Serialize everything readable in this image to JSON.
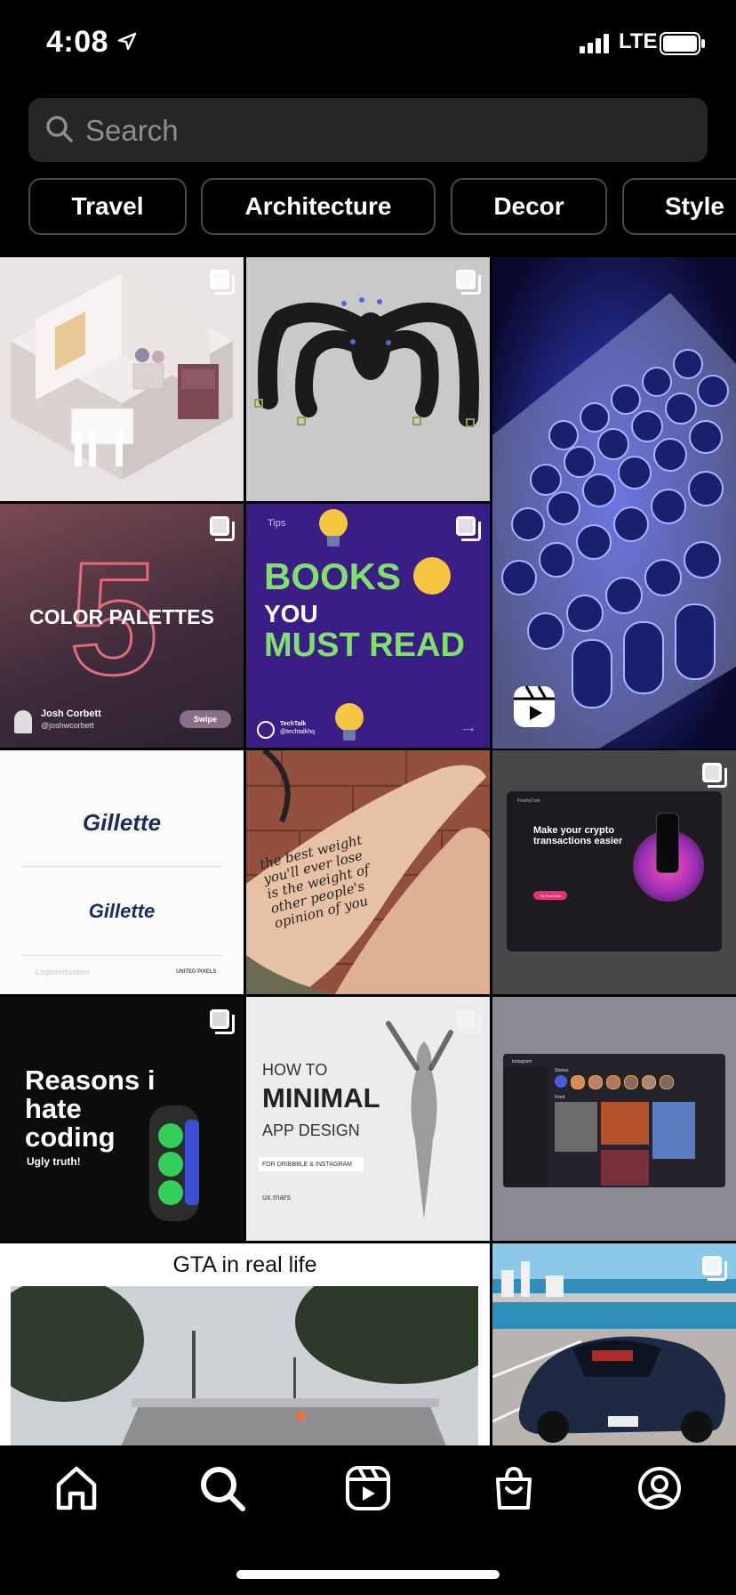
{
  "status": {
    "time": "4:08",
    "network": "LTE"
  },
  "search": {
    "placeholder": "Search"
  },
  "chips": [
    "Travel",
    "Architecture",
    "Decor",
    "Style"
  ],
  "posts": {
    "color_palettes": {
      "number": "5",
      "title": "COLOR PALETTES",
      "author": "Josh Corbett",
      "handle": "@joshwcorbett",
      "swipe": "Swipe"
    },
    "books": {
      "tag": "Tips",
      "line1": "BOOKS",
      "line2": "YOU",
      "line3": "MUST READ",
      "brand": "TechTalk",
      "brand_handle": "@techtalkhq"
    },
    "gillette": {
      "logo_top": "Gillette",
      "logo_bottom": "Gillette",
      "credit_left": "Logomotivation",
      "credit_right": "UNITED PIXELS"
    },
    "legs": {
      "text": "the best weight you'll ever lose is the weight of other people's opinion of you"
    },
    "crypto": {
      "brand": "FreshyCoin",
      "headline": "Make your crypto transactions easier",
      "cta": "Try Free Now"
    },
    "coding": {
      "line1": "Reasons i",
      "line2": "hate",
      "line3": "coding",
      "sub": "Ugly truth!"
    },
    "minimal": {
      "line1": "HOW TO",
      "line2": "MINIMAL",
      "line3": "APP DESIGN",
      "line4": "FOR DRIBBBLE & INSTAGRAM",
      "author": "ux.mars"
    },
    "dashboard": {
      "brand": "Instagram",
      "stories": "Stories",
      "feed": "Feed"
    },
    "gta": {
      "title": "GTA in real life"
    }
  },
  "colors": {
    "background": "#000000",
    "chip_border": "#4a4a4a",
    "search_bg": "#262626",
    "placeholder": "#8e8e8e"
  }
}
